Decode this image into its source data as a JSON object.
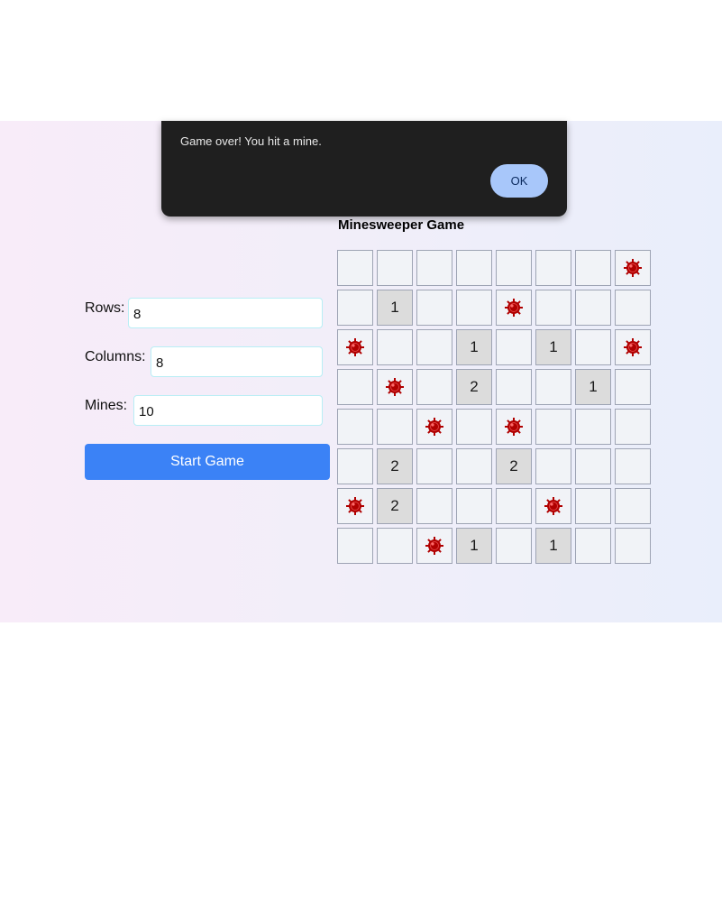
{
  "dialog": {
    "message": "Game over! You hit a mine.",
    "ok_label": "OK"
  },
  "game": {
    "title": "Minesweeper Game"
  },
  "settings": {
    "rows_label": "Rows:",
    "rows_value": "8",
    "columns_label": "Columns:",
    "columns_value": "8",
    "mines_label": "Mines:",
    "mines_value": "10",
    "start_label": "Start Game"
  },
  "board": {
    "mine_icon": "mine-icon",
    "mine_color": "#b00000",
    "rows": [
      [
        " ",
        " ",
        " ",
        " ",
        " ",
        " ",
        " ",
        "*"
      ],
      [
        " ",
        "1",
        " ",
        " ",
        "*",
        " ",
        " ",
        " "
      ],
      [
        "*",
        " ",
        " ",
        "1",
        " ",
        "1",
        " ",
        "*"
      ],
      [
        " ",
        "*",
        " ",
        "2",
        " ",
        " ",
        "1",
        " "
      ],
      [
        " ",
        " ",
        "*",
        " ",
        "*",
        " ",
        " ",
        " "
      ],
      [
        " ",
        "2",
        " ",
        " ",
        "2",
        " ",
        " ",
        " "
      ],
      [
        "*",
        "2",
        " ",
        " ",
        " ",
        "*",
        " ",
        " "
      ],
      [
        " ",
        " ",
        "*",
        "1",
        " ",
        "1",
        " ",
        " "
      ]
    ]
  }
}
